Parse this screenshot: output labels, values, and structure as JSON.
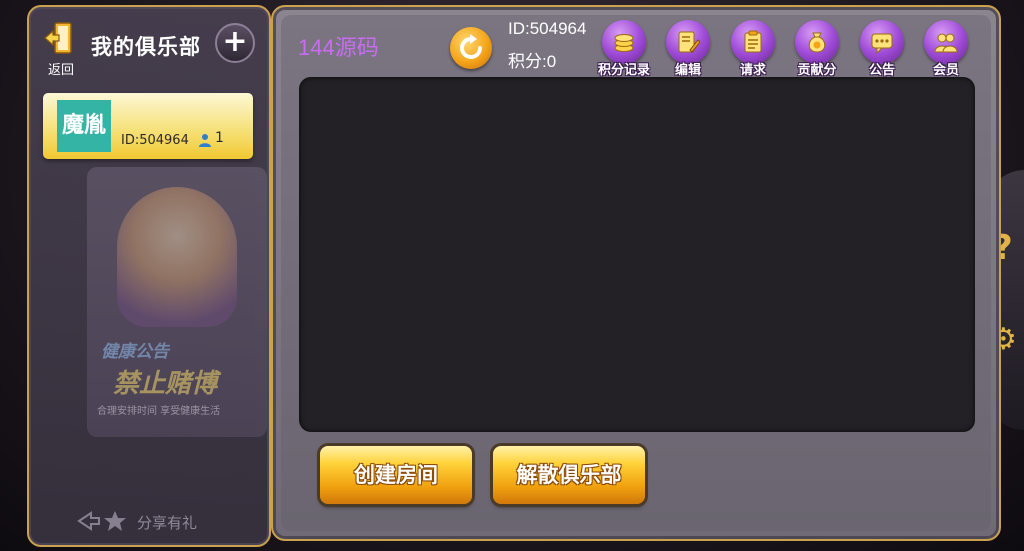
{
  "left_panel": {
    "back_label": "返回",
    "title": "我的俱乐部",
    "club": {
      "avatar_text": "魔胤",
      "id_text": "ID:504964",
      "member_count": "1"
    },
    "promo": {
      "line1": "健康公告",
      "line2": "禁止赌博",
      "line3": "合理安排时间 享受健康生活"
    },
    "share_label": "分享有礼"
  },
  "main": {
    "club_name": "144源码",
    "user_id": "ID:504964",
    "user_points": "积分:0",
    "tools": [
      {
        "label": "积分记录",
        "icon": "coins-icon"
      },
      {
        "label": "编辑",
        "icon": "edit-icon"
      },
      {
        "label": "请求",
        "icon": "request-icon"
      },
      {
        "label": "贡献分",
        "icon": "contribution-icon"
      },
      {
        "label": "公告",
        "icon": "notice-icon"
      },
      {
        "label": "会员",
        "icon": "members-icon"
      }
    ],
    "create_room_label": "创建房间",
    "dissolve_club_label": "解散俱乐部"
  },
  "colors": {
    "gold_border": "#caa24e",
    "club_name": "#c86cf2",
    "avatar_bg": "#34b4a4"
  }
}
